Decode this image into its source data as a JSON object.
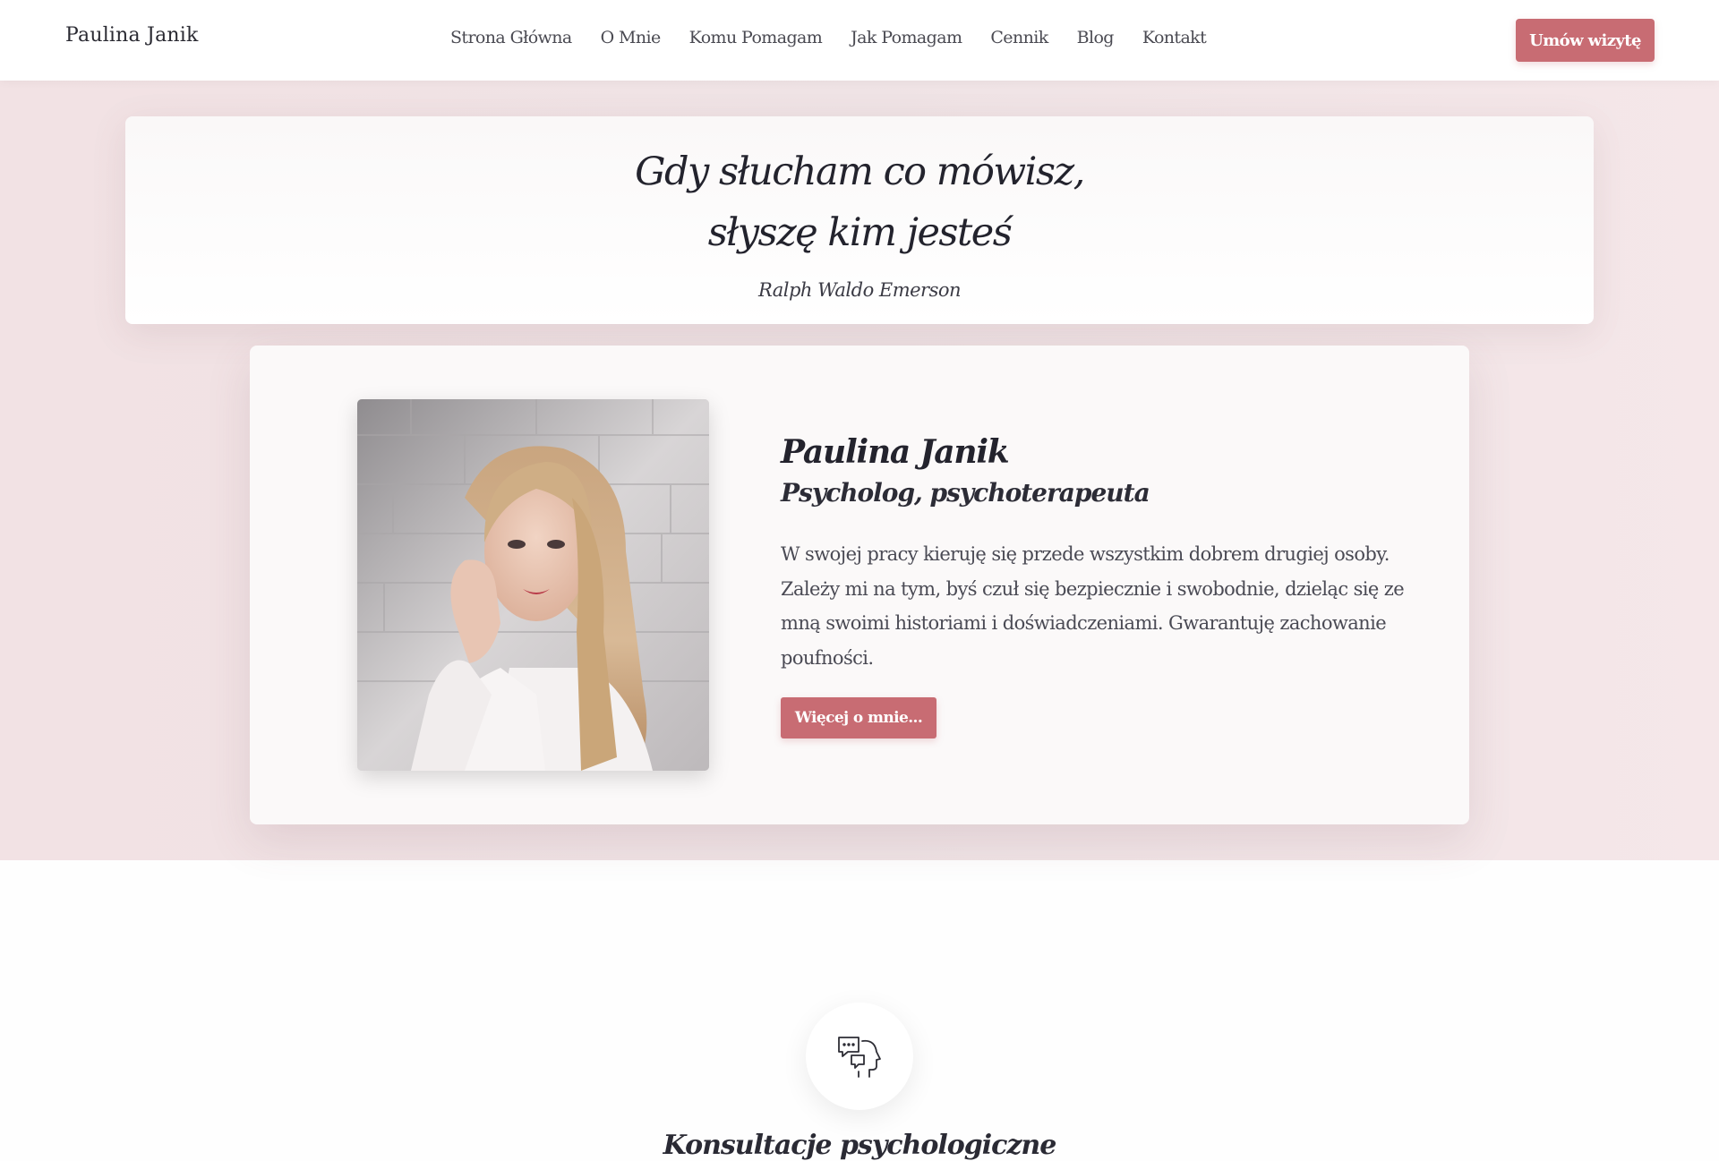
{
  "header": {
    "brand": "Paulina Janik",
    "nav": [
      "Strona Główna",
      "O Mnie",
      "Komu Pomagam",
      "Jak Pomagam",
      "Cennik",
      "Blog",
      "Kontakt"
    ],
    "cta_label": "Umów wizytę"
  },
  "quote": {
    "line1": "Gdy słucham co mówisz,",
    "line2": "słyszę kim jesteś",
    "author": "Ralph Waldo Emerson"
  },
  "profile": {
    "name": "Paulina Janik",
    "role": "Psycholog, psychoterapeuta",
    "bio": "W swojej pracy kieruję się przede wszystkim dobrem drugiej osoby. Zależy mi na tym, byś czuł się bezpiecznie i swobodnie, dzieląc się ze mną swoimi historiami i doświadczeniami. Gwarantuję zachowanie poufności.",
    "more_label": "Więcej o mnie..."
  },
  "services": {
    "icon": "consultation-head-speech-icon",
    "first_title": "Konsultacje psychologiczne"
  },
  "colors": {
    "accent": "#c86c73",
    "hero_bg": "#f2e2e4",
    "text_dark": "#23232d"
  }
}
